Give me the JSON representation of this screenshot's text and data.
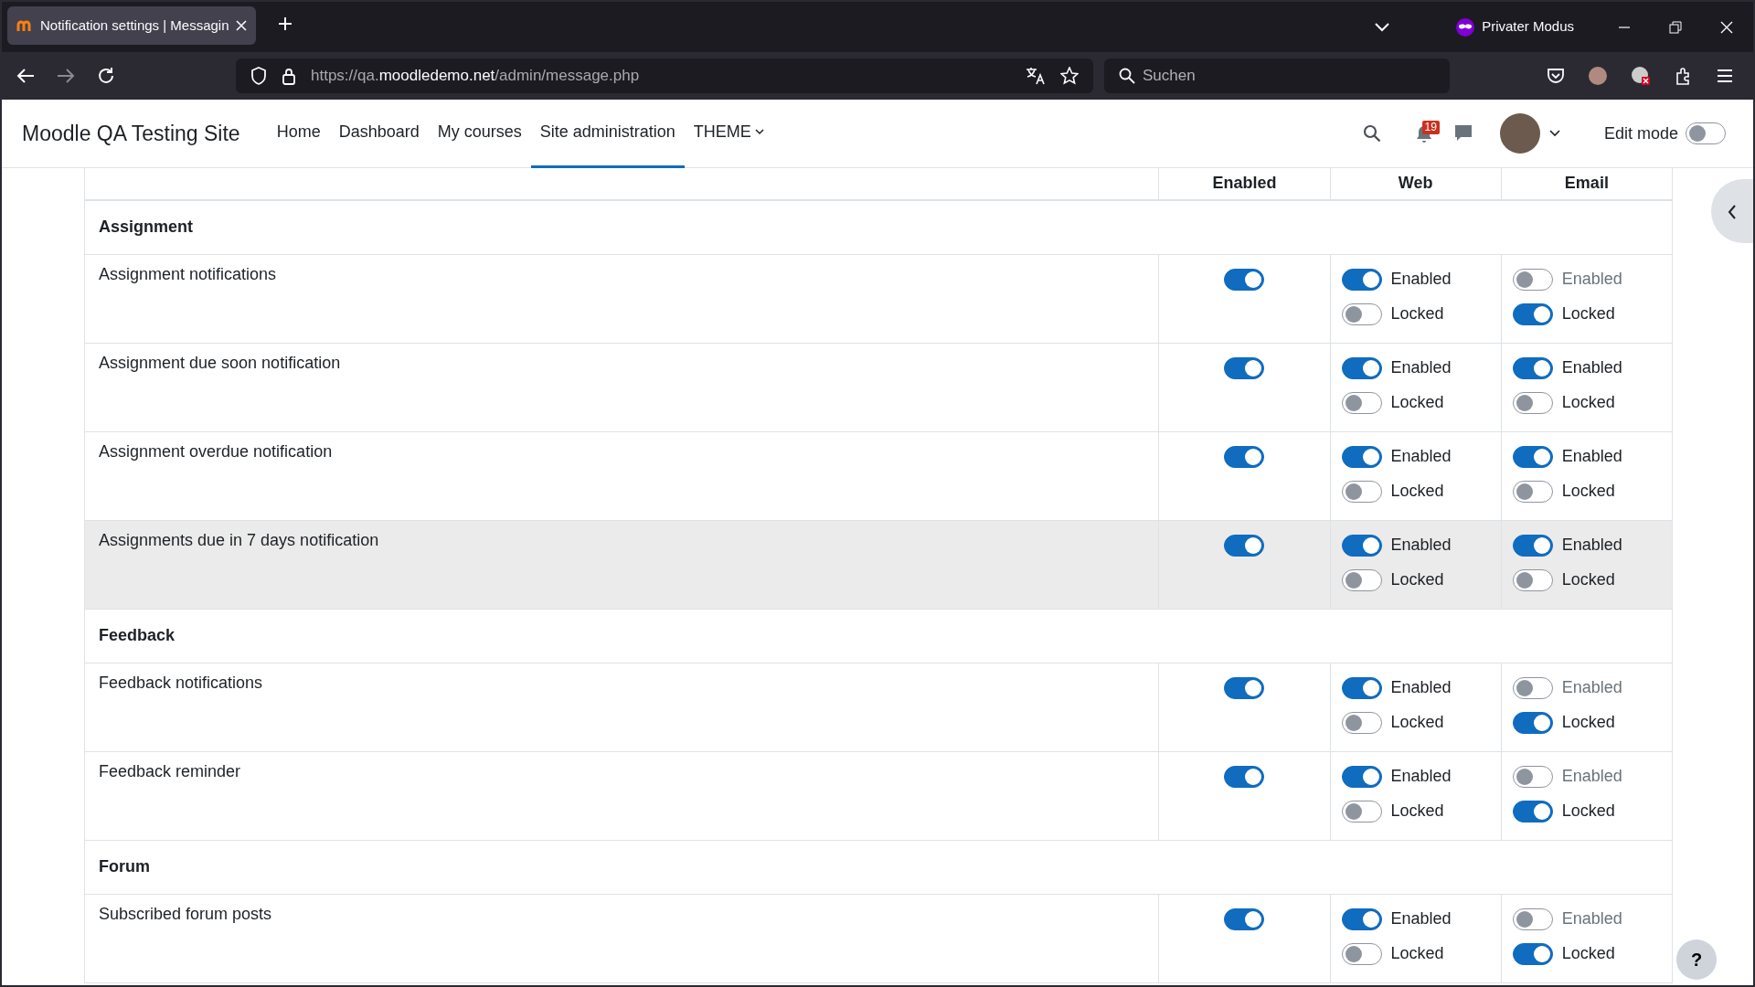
{
  "browser": {
    "tab_title": "Notification settings | Messagin",
    "address": {
      "prefix": "https://qa.",
      "domain": "moodledemo.net",
      "path": "/admin/message.php"
    },
    "search": {
      "placeholder": "Suchen"
    },
    "private_label": "Privater Modus"
  },
  "navbar": {
    "site_name": "Moodle QA Testing Site",
    "items": [
      {
        "label": "Home",
        "selected": false
      },
      {
        "label": "Dashboard",
        "selected": false
      },
      {
        "label": "My courses",
        "selected": false
      },
      {
        "label": "Site administration",
        "selected": true
      },
      {
        "label": "THEME",
        "selected": false,
        "dropdown": true
      }
    ],
    "notification_count": "19",
    "edit_mode": {
      "label": "Edit mode",
      "on": false
    }
  },
  "table": {
    "columns": [
      "",
      "Enabled",
      "Web",
      "Email"
    ],
    "rows": [
      {
        "kind": "section",
        "name": "Assignment"
      },
      {
        "kind": "notification",
        "name": "Assignment notifications",
        "highlighted": false,
        "enabled": true,
        "web": [
          {
            "label": "Enabled",
            "on": true,
            "disabled": false
          },
          {
            "label": "Locked",
            "on": false,
            "disabled": false
          }
        ],
        "email": [
          {
            "label": "Enabled",
            "on": false,
            "disabled": true
          },
          {
            "label": "Locked",
            "on": true,
            "disabled": false
          }
        ]
      },
      {
        "kind": "notification",
        "name": "Assignment due soon notification",
        "highlighted": false,
        "enabled": true,
        "web": [
          {
            "label": "Enabled",
            "on": true,
            "disabled": false
          },
          {
            "label": "Locked",
            "on": false,
            "disabled": false
          }
        ],
        "email": [
          {
            "label": "Enabled",
            "on": true,
            "disabled": false
          },
          {
            "label": "Locked",
            "on": false,
            "disabled": false
          }
        ]
      },
      {
        "kind": "notification",
        "name": "Assignment overdue notification",
        "highlighted": false,
        "enabled": true,
        "web": [
          {
            "label": "Enabled",
            "on": true,
            "disabled": false
          },
          {
            "label": "Locked",
            "on": false,
            "disabled": false
          }
        ],
        "email": [
          {
            "label": "Enabled",
            "on": true,
            "disabled": false
          },
          {
            "label": "Locked",
            "on": false,
            "disabled": false
          }
        ]
      },
      {
        "kind": "notification",
        "name": "Assignments due in 7 days notification",
        "highlighted": true,
        "enabled": true,
        "web": [
          {
            "label": "Enabled",
            "on": true,
            "disabled": false
          },
          {
            "label": "Locked",
            "on": false,
            "disabled": false
          }
        ],
        "email": [
          {
            "label": "Enabled",
            "on": true,
            "disabled": false
          },
          {
            "label": "Locked",
            "on": false,
            "disabled": false
          }
        ]
      },
      {
        "kind": "section",
        "name": "Feedback"
      },
      {
        "kind": "notification",
        "name": "Feedback notifications",
        "highlighted": false,
        "enabled": true,
        "web": [
          {
            "label": "Enabled",
            "on": true,
            "disabled": false
          },
          {
            "label": "Locked",
            "on": false,
            "disabled": false
          }
        ],
        "email": [
          {
            "label": "Enabled",
            "on": false,
            "disabled": true
          },
          {
            "label": "Locked",
            "on": true,
            "disabled": false
          }
        ]
      },
      {
        "kind": "notification",
        "name": "Feedback reminder",
        "highlighted": false,
        "enabled": true,
        "web": [
          {
            "label": "Enabled",
            "on": true,
            "disabled": false
          },
          {
            "label": "Locked",
            "on": false,
            "disabled": false
          }
        ],
        "email": [
          {
            "label": "Enabled",
            "on": false,
            "disabled": true
          },
          {
            "label": "Locked",
            "on": true,
            "disabled": false
          }
        ]
      },
      {
        "kind": "section",
        "name": "Forum"
      },
      {
        "kind": "notification",
        "name": "Subscribed forum posts",
        "highlighted": false,
        "enabled": true,
        "web": [
          {
            "label": "Enabled",
            "on": true,
            "disabled": false
          },
          {
            "label": "Locked",
            "on": false,
            "disabled": false
          }
        ],
        "email": [
          {
            "label": "Enabled",
            "on": false,
            "disabled": true
          },
          {
            "label": "Locked",
            "on": true,
            "disabled": false
          }
        ]
      }
    ]
  },
  "help_button": "?"
}
